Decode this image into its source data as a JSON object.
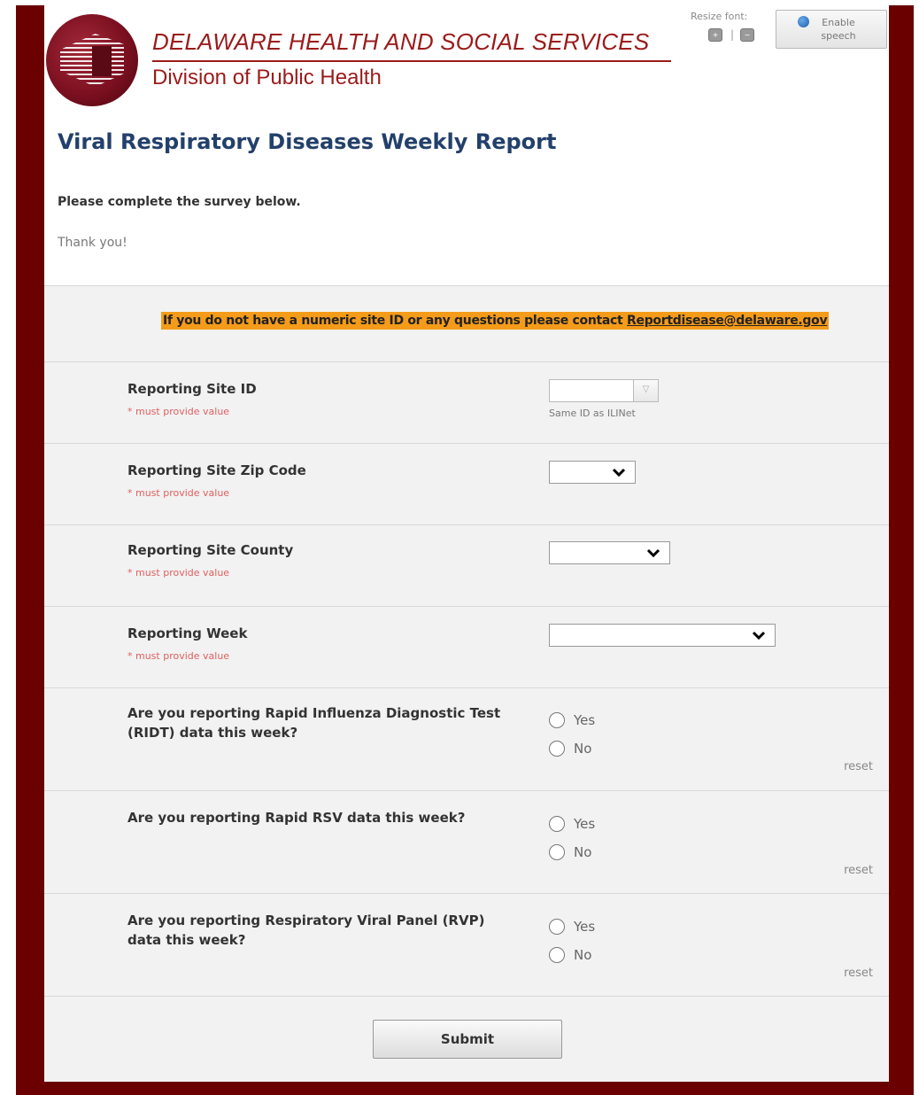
{
  "header": {
    "org_name": "DELAWARE HEALTH AND SOCIAL SERVICES",
    "division": "Division of Public Health",
    "resize_font_label": "Resize font:",
    "font_increase": "+",
    "font_decrease": "−",
    "enable_speech_label": "Enable speech"
  },
  "page": {
    "title": "Viral Respiratory Diseases Weekly Report",
    "intro": "Please complete the survey below.",
    "thanks": "Thank you!"
  },
  "notice": {
    "text": "If you do not have a numeric site ID or any questions please contact ",
    "email": "Reportdisease@delaware.gov"
  },
  "form": {
    "required_text": "* must provide value",
    "fields": [
      {
        "label": "Reporting Site ID",
        "value": "",
        "hint": "Same ID as ILINet"
      },
      {
        "label": "Reporting Site Zip Code",
        "value": ""
      },
      {
        "label": "Reporting Site County",
        "value": ""
      },
      {
        "label": "Reporting Week",
        "value": ""
      }
    ],
    "radio_questions": [
      {
        "label": "Are you reporting Rapid Influenza Diagnostic Test (RIDT) data this week?"
      },
      {
        "label": "Are you reporting Rapid RSV data this week?"
      },
      {
        "label": "Are you reporting Respiratory Viral Panel (RVP) data this week?"
      }
    ],
    "option_yes": "Yes",
    "option_no": "No",
    "reset_label": "reset",
    "submit_label": "Submit"
  }
}
